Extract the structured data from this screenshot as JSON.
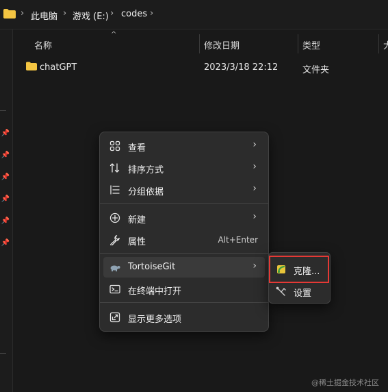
{
  "address_bar": {
    "crumbs": [
      "此电脑",
      "游戏 (E:)",
      "codes"
    ],
    "separator": "›",
    "folder_icon": "folder-icon"
  },
  "columns": [
    "名称",
    "修改日期",
    "类型",
    "大"
  ],
  "files": [
    {
      "name": "chatGPT",
      "modified": "2023/3/18 22:12",
      "type": "文件夹",
      "icon": "folder-icon"
    }
  ],
  "context_menu": {
    "items": [
      {
        "label": "查看",
        "icon": "view-icon",
        "submenu": true
      },
      {
        "label": "排序方式",
        "icon": "sort-icon",
        "submenu": true
      },
      {
        "label": "分组依据",
        "icon": "group-icon",
        "submenu": true
      },
      {
        "label": "新建",
        "icon": "new-icon",
        "submenu": true
      },
      {
        "label": "属性",
        "icon": "wrench-icon",
        "shortcut": "Alt+Enter"
      },
      {
        "label": "TortoiseGit",
        "icon": "tortoise-icon",
        "submenu": true,
        "highlighted": true
      },
      {
        "label": "在终端中打开",
        "icon": "terminal-icon"
      },
      {
        "label": "显示更多选项",
        "icon": "more-options-icon"
      }
    ],
    "arrow": "›"
  },
  "submenu": {
    "items": [
      {
        "label": "克隆...",
        "icon": "clone-icon",
        "highlighted": true
      },
      {
        "label": "设置",
        "icon": "settings-icon"
      }
    ]
  },
  "watermark": "@稀土掘金技术社区",
  "colors": {
    "folder": "#f4c542",
    "highlight_box": "#e53935",
    "background": "#191919",
    "menu": "#2c2c2c"
  }
}
